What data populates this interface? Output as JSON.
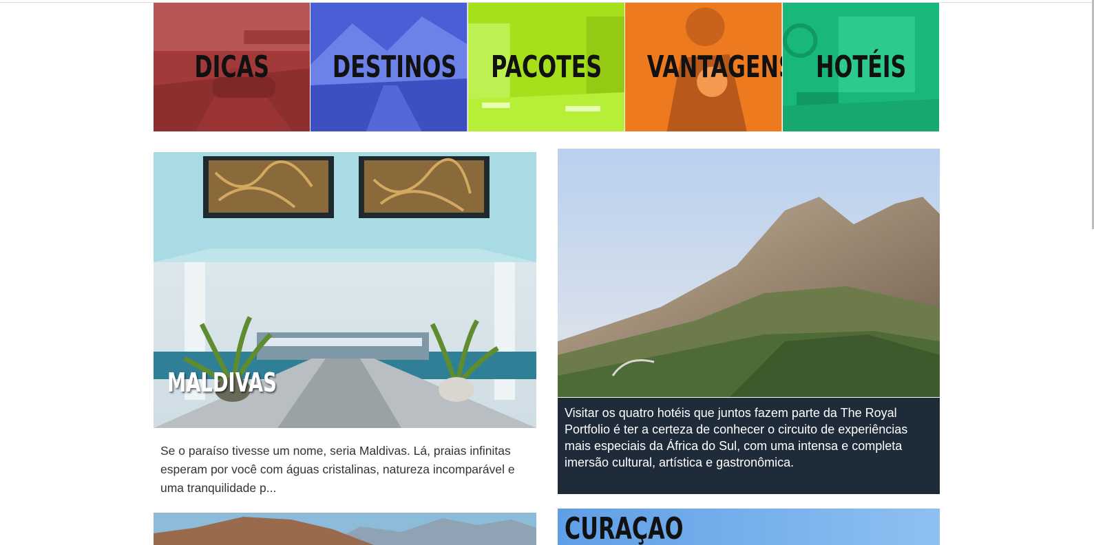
{
  "categories": [
    {
      "label": "DICAS",
      "color": "#a33a3a"
    },
    {
      "label": "DESTINOS",
      "color": "#4a5fd6"
    },
    {
      "label": "PACOTES",
      "color": "#a6e01a"
    },
    {
      "label": "VANTAGENS",
      "color": "#ee7a1f"
    },
    {
      "label": "HOTÉIS",
      "color": "#19b87a"
    }
  ],
  "articles": {
    "maldivas": {
      "title": "MALDIVAS",
      "excerpt": "Se o paraíso tivesse um nome, seria Maldivas. Lá, praias infinitas esperam por você com águas cristalinas, natureza incomparável e uma tranquilidade p..."
    },
    "royal_portfolio": {
      "caption": "Visitar os quatro hotéis que juntos fazem parte da The Royal Portfolio é ter a certeza de conhecer o circuito de experiências mais especiais da África do Sul, com uma intensa e completa imersão cultural, artística e gastronômica."
    },
    "curacao": {
      "title": "CURAÇAO"
    }
  }
}
